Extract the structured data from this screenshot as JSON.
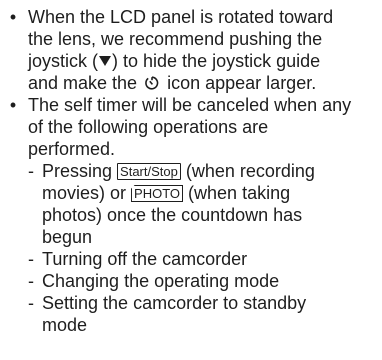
{
  "bullet1": {
    "line1": "When the LCD panel is rotated toward",
    "line2": "the lens, we recommend pushing the",
    "line3_pre": "joystick (",
    "line3_post": ") to hide the joystick guide",
    "line4_pre": "and make the",
    "line4_post": "icon appear larger."
  },
  "bullet2": {
    "line1": "The self timer will be canceled when any",
    "line2": "of the following operations are",
    "line3": "performed.",
    "items": [
      {
        "pre": "Pressing",
        "key1": "Start/Stop",
        "mid": "(when recording",
        "line2_pre": "movies) or",
        "key2": "PHOTO",
        "line2_post": "(when taking",
        "line3": "photos) once the countdown has",
        "line4": "begun"
      },
      {
        "text": "Turning off the camcorder"
      },
      {
        "text": "Changing the operating mode"
      },
      {
        "line1": "Setting the camcorder to standby",
        "line2": "mode"
      }
    ]
  },
  "symbols": {
    "bullet": "•",
    "dash": "-",
    "joystick_down": "down-triangle-icon",
    "self_timer": "self-timer-icon"
  }
}
